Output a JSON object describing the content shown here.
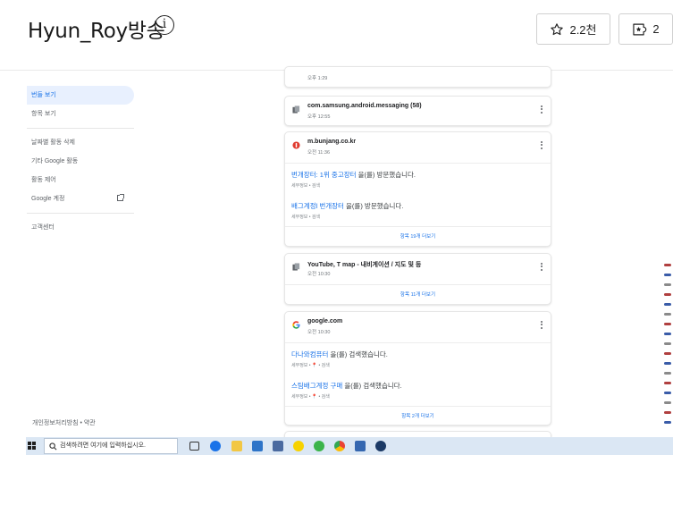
{
  "header": {
    "title": "Hyun_Roy방송",
    "info_glyph": "i",
    "star_count": "2.2천",
    "bookmark_count": "2"
  },
  "sidebar": {
    "items": [
      {
        "label": "번들 보기"
      },
      {
        "label": "항목 보기"
      },
      {
        "label": "날짜별 활동 삭제"
      },
      {
        "label": "기타 Google 활동"
      },
      {
        "label": "활동 제어"
      },
      {
        "label": "Google 계정"
      },
      {
        "label": "고객센터"
      }
    ],
    "footer": "개인정보처리방침 • 약관"
  },
  "cards": [
    {
      "time": "오후 1:29",
      "more": ""
    },
    {
      "title": "com.samsung.android.messaging (58)",
      "time": "오후 12:55"
    },
    {
      "title": "m.bunjang.co.kr",
      "time": "오전 11:36",
      "entries": [
        {
          "link": "번개장터: 1위 중고장터",
          "rest": " 을(를) 방문했습니다.",
          "sub": "세부정보 • 검색"
        },
        {
          "link": "배그계정l 번개장터",
          "rest": " 을(를) 방문했습니다.",
          "sub": "세부정보 • 검색"
        }
      ],
      "more": "항목 19개 더보기"
    },
    {
      "title": "YouTube, T map - 내비게이션 / 지도 및 등",
      "time": "오전 10:30",
      "more": "항목 11개 더보기"
    },
    {
      "title": "google.com",
      "time": "오전 10:30",
      "entries": [
        {
          "link": "다나와컴퓨터",
          "rest": " 을(를) 검색했습니다.",
          "sub": "세부정보 • 📍 • 검색"
        },
        {
          "link": "스팀배그계정 구매",
          "rest": " 을(를) 검색했습니다.",
          "sub": "세부정보 • 📍 • 검색"
        }
      ],
      "more": "항목 2개 더보기"
    }
  ],
  "taskbar": {
    "search_placeholder": "검색하려면 여기에 입력하십시오.",
    "icons": [
      "task-view-icon",
      "edge-icon",
      "file-explorer-icon",
      "mail-icon",
      "laptop-icon",
      "kakaotalk-icon",
      "green-app-icon",
      "chrome-icon",
      "store-icon",
      "steam-icon"
    ]
  },
  "colors": {
    "accent": "#1a73e8",
    "taskbar": "#dbe7f4"
  }
}
